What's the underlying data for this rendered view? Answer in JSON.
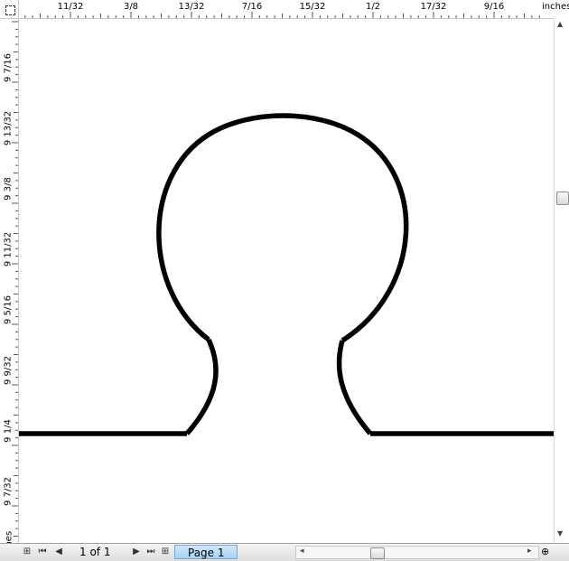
{
  "rulers": {
    "units": "inches",
    "top_ticks": [
      "11/32",
      "3/8",
      "13/32",
      "7/16",
      "15/32",
      "1/2",
      "17/32",
      "9/16"
    ],
    "left_ticks": [
      "9 7/16",
      "9 13/32",
      "9 3/8",
      "9 11/32",
      "9 5/16",
      "9 9/32",
      "9 1/4",
      "9 7/32"
    ]
  },
  "footer": {
    "page_count": "1 of 1",
    "page_tab": "Page 1"
  },
  "colors": {
    "stroke": "#000000",
    "ruler_border": "#c8c8c8",
    "tab_active": "#a7d2f5"
  },
  "icons": [
    "ruler-origin-icon",
    "insert-page-before-icon",
    "first-page-icon",
    "previous-page-icon",
    "next-page-icon",
    "last-page-icon",
    "insert-page-after-icon",
    "zoom-icon",
    "scroll-left-icon",
    "scroll-right-icon"
  ]
}
